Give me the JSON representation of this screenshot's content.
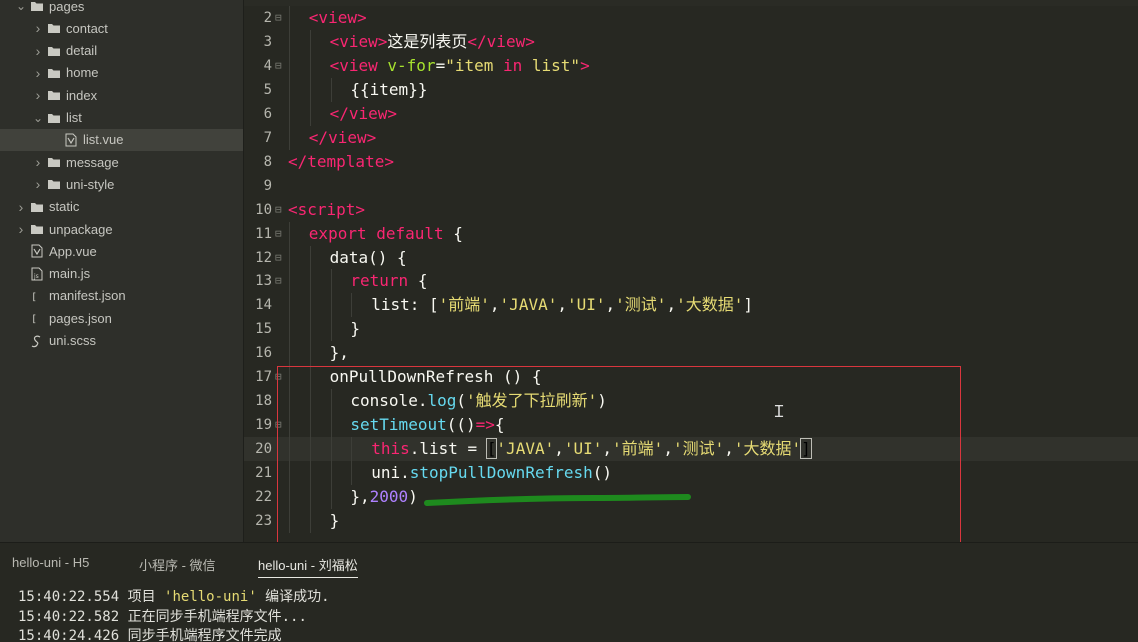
{
  "sidebar": {
    "items": [
      {
        "label": "pages",
        "icon": "folder-icon",
        "level": 1,
        "expanded": true,
        "type": "folder"
      },
      {
        "label": "contact",
        "icon": "folder-icon",
        "level": 2,
        "expanded": false,
        "type": "folder"
      },
      {
        "label": "detail",
        "icon": "folder-icon",
        "level": 2,
        "expanded": false,
        "type": "folder"
      },
      {
        "label": "home",
        "icon": "folder-icon",
        "level": 2,
        "expanded": false,
        "type": "folder"
      },
      {
        "label": "index",
        "icon": "folder-icon",
        "level": 2,
        "expanded": false,
        "type": "folder"
      },
      {
        "label": "list",
        "icon": "folder-icon",
        "level": 2,
        "expanded": true,
        "type": "folder"
      },
      {
        "label": "list.vue",
        "icon": "vue-file-icon",
        "level": 3,
        "type": "file",
        "selected": true
      },
      {
        "label": "message",
        "icon": "folder-icon",
        "level": 2,
        "expanded": false,
        "type": "folder"
      },
      {
        "label": "uni-style",
        "icon": "folder-icon",
        "level": 2,
        "expanded": false,
        "type": "folder"
      },
      {
        "label": "static",
        "icon": "folder-icon",
        "level": 1,
        "expanded": false,
        "type": "folder"
      },
      {
        "label": "unpackage",
        "icon": "folder-icon",
        "level": 1,
        "expanded": false,
        "type": "folder"
      },
      {
        "label": "App.vue",
        "icon": "vue-file-icon",
        "level": 1,
        "type": "file"
      },
      {
        "label": "main.js",
        "icon": "js-file-icon",
        "level": 1,
        "type": "file"
      },
      {
        "label": "manifest.json",
        "icon": "json-file-icon",
        "level": 1,
        "type": "file"
      },
      {
        "label": "pages.json",
        "icon": "json-file-icon",
        "level": 1,
        "type": "file"
      },
      {
        "label": "uni.scss",
        "icon": "scss-file-icon",
        "level": 1,
        "type": "file"
      }
    ]
  },
  "editor": {
    "current_line": 20,
    "lines": [
      {
        "n": "2",
        "fold": true,
        "indent": 1,
        "tokens": [
          [
            "t-tag",
            "<view>"
          ]
        ]
      },
      {
        "n": "3",
        "fold": false,
        "indent": 2,
        "tokens": [
          [
            "t-tag",
            "<view>"
          ],
          [
            "t-plain",
            "这是列表页"
          ],
          [
            "t-tag",
            "</view>"
          ]
        ]
      },
      {
        "n": "4",
        "fold": true,
        "indent": 2,
        "tokens": [
          [
            "t-tag",
            "<view "
          ],
          [
            "t-attr",
            "v-for"
          ],
          [
            "t-plain",
            "="
          ],
          [
            "t-str",
            "\"item "
          ],
          [
            "t-kw",
            "in"
          ],
          [
            "t-str",
            " list\""
          ],
          [
            "t-tag",
            ">"
          ]
        ]
      },
      {
        "n": "5",
        "fold": false,
        "indent": 3,
        "tokens": [
          [
            "t-plain",
            "{{item}}"
          ]
        ]
      },
      {
        "n": "6",
        "fold": false,
        "indent": 2,
        "tokens": [
          [
            "t-tag",
            "</view>"
          ]
        ]
      },
      {
        "n": "7",
        "fold": false,
        "indent": 1,
        "tokens": [
          [
            "t-tag",
            "</view>"
          ]
        ]
      },
      {
        "n": "8",
        "fold": false,
        "indent": 0,
        "tokens": [
          [
            "t-tag",
            "</template>"
          ]
        ]
      },
      {
        "n": "9",
        "fold": false,
        "indent": 0,
        "tokens": []
      },
      {
        "n": "10",
        "fold": true,
        "indent": 0,
        "tokens": [
          [
            "t-tag",
            "<script>"
          ]
        ]
      },
      {
        "n": "11",
        "fold": true,
        "indent": 1,
        "tokens": [
          [
            "t-kw",
            "export "
          ],
          [
            "t-kw",
            "default "
          ],
          [
            "t-plain",
            "{"
          ]
        ]
      },
      {
        "n": "12",
        "fold": true,
        "indent": 2,
        "tokens": [
          [
            "t-plain",
            "data() {"
          ]
        ]
      },
      {
        "n": "13",
        "fold": true,
        "indent": 3,
        "tokens": [
          [
            "t-ctl",
            "return "
          ],
          [
            "t-plain",
            "{"
          ]
        ]
      },
      {
        "n": "14",
        "fold": false,
        "indent": 4,
        "tokens": [
          [
            "t-plain",
            "list: ["
          ],
          [
            "t-str",
            "'前端'"
          ],
          [
            "t-plain",
            ","
          ],
          [
            "t-str",
            "'JAVA'"
          ],
          [
            "t-plain",
            ","
          ],
          [
            "t-str",
            "'UI'"
          ],
          [
            "t-plain",
            ","
          ],
          [
            "t-str",
            "'测试'"
          ],
          [
            "t-plain",
            ","
          ],
          [
            "t-str",
            "'大数据'"
          ],
          [
            "t-plain",
            "]"
          ]
        ]
      },
      {
        "n": "15",
        "fold": false,
        "indent": 3,
        "tokens": [
          [
            "t-plain",
            "}"
          ]
        ]
      },
      {
        "n": "16",
        "fold": false,
        "indent": 2,
        "tokens": [
          [
            "t-plain",
            "},"
          ]
        ]
      },
      {
        "n": "17",
        "fold": true,
        "indent": 2,
        "tokens": [
          [
            "t-plain",
            "onPullDownRefresh () {"
          ]
        ]
      },
      {
        "n": "18",
        "fold": false,
        "indent": 3,
        "tokens": [
          [
            "t-plain",
            "console."
          ],
          [
            "t-fn",
            "log"
          ],
          [
            "t-plain",
            "("
          ],
          [
            "t-str",
            "'触发了下拉刷新'"
          ],
          [
            "t-plain",
            ")"
          ]
        ]
      },
      {
        "n": "19",
        "fold": true,
        "indent": 3,
        "tokens": [
          [
            "t-fn",
            "setTimeout"
          ],
          [
            "t-plain",
            "(()"
          ],
          [
            "t-op",
            "=>"
          ],
          [
            "t-plain",
            "{"
          ]
        ]
      },
      {
        "n": "20",
        "fold": false,
        "indent": 4,
        "tokens": [
          [
            "t-kw",
            "this"
          ],
          [
            "t-plain",
            ".list = "
          ],
          [
            "t-brk",
            "["
          ],
          [
            "t-str",
            "'JAVA'"
          ],
          [
            "t-plain",
            ","
          ],
          [
            "t-str",
            "'UI'"
          ],
          [
            "t-plain",
            ","
          ],
          [
            "t-str",
            "'前端'"
          ],
          [
            "t-plain",
            ","
          ],
          [
            "t-str",
            "'测试'"
          ],
          [
            "t-plain",
            ","
          ],
          [
            "t-str",
            "'大数据'"
          ],
          [
            "t-brk",
            "]"
          ]
        ]
      },
      {
        "n": "21",
        "fold": false,
        "indent": 4,
        "tokens": [
          [
            "t-plain",
            "uni."
          ],
          [
            "t-fn",
            "stopPullDownRefresh"
          ],
          [
            "t-plain",
            "()"
          ]
        ]
      },
      {
        "n": "22",
        "fold": false,
        "indent": 3,
        "tokens": [
          [
            "t-plain",
            "},"
          ],
          [
            "t-num",
            "2000"
          ],
          [
            "t-plain",
            ")"
          ]
        ]
      },
      {
        "n": "23",
        "fold": false,
        "indent": 2,
        "tokens": [
          [
            "t-plain",
            "}"
          ]
        ]
      }
    ]
  },
  "console": {
    "tabs": [
      {
        "label": "hello-uni - H5",
        "active": false
      },
      {
        "label": "小程序 - 微信",
        "active": false
      },
      {
        "label": "hello-uni - 刘福松",
        "active": true
      }
    ],
    "logs": [
      {
        "time": "15:40:22.554",
        "parts": [
          [
            "log-msg",
            "项目 "
          ],
          [
            "log-hl",
            "'hello-uni'"
          ],
          [
            "log-msg",
            " 编译成功."
          ]
        ]
      },
      {
        "time": "15:40:22.582",
        "parts": [
          [
            "log-msg",
            "正在同步手机端程序文件..."
          ]
        ]
      },
      {
        "time": "15:40:24.426",
        "parts": [
          [
            "log-msg",
            "同步手机端程序文件完成"
          ]
        ]
      }
    ]
  },
  "colors": {
    "annotation_box": "#d9363e",
    "annotation_underline": "#1e8a1e"
  }
}
